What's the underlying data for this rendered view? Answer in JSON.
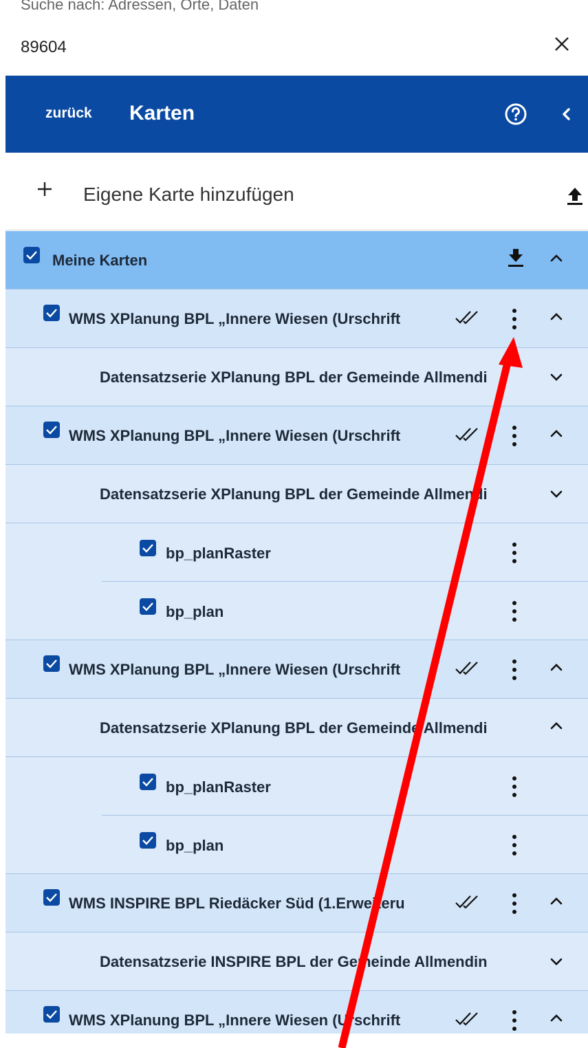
{
  "search": {
    "placeholder": "Suche nach: Adressen, Orte, Daten",
    "value": "89604"
  },
  "header": {
    "back_label": "zurück",
    "title": "Karten",
    "color": "#0b4aa2"
  },
  "add_map": {
    "label": "Eigene Karte hinzufügen"
  },
  "tree": {
    "group_label": "Meine Karten",
    "items": [
      {
        "label": "WMS XPlanung BPL „Innere Wiesen (Urschrift"
      },
      {
        "label": "Datensatzserie XPlanung BPL der Gemeinde Allmendi"
      },
      {
        "label": "WMS XPlanung BPL „Innere Wiesen (Urschrift"
      },
      {
        "label": "Datensatzserie XPlanung BPL der Gemeinde Allmendi"
      },
      {
        "label": "bp_planRaster"
      },
      {
        "label": "bp_plan"
      },
      {
        "label": "WMS XPlanung BPL „Innere Wiesen (Urschrift"
      },
      {
        "label": "Datensatzserie XPlanung BPL der Gemeinde Allmendi"
      },
      {
        "label": "bp_planRaster"
      },
      {
        "label": "bp_plan"
      },
      {
        "label": "WMS INSPIRE BPL Riedäcker Süd (1.Erweiteru"
      },
      {
        "label": "Datensatzserie INSPIRE BPL der Gemeinde Allmendin"
      },
      {
        "label": "WMS XPlanung BPL „Innere Wiesen (Urschrift"
      }
    ]
  },
  "colors": {
    "group_row": "#80bbf2",
    "layer_row": "#d3e5f8",
    "sub_row": "#dceafa",
    "annotation_arrow": "#ff0000"
  }
}
